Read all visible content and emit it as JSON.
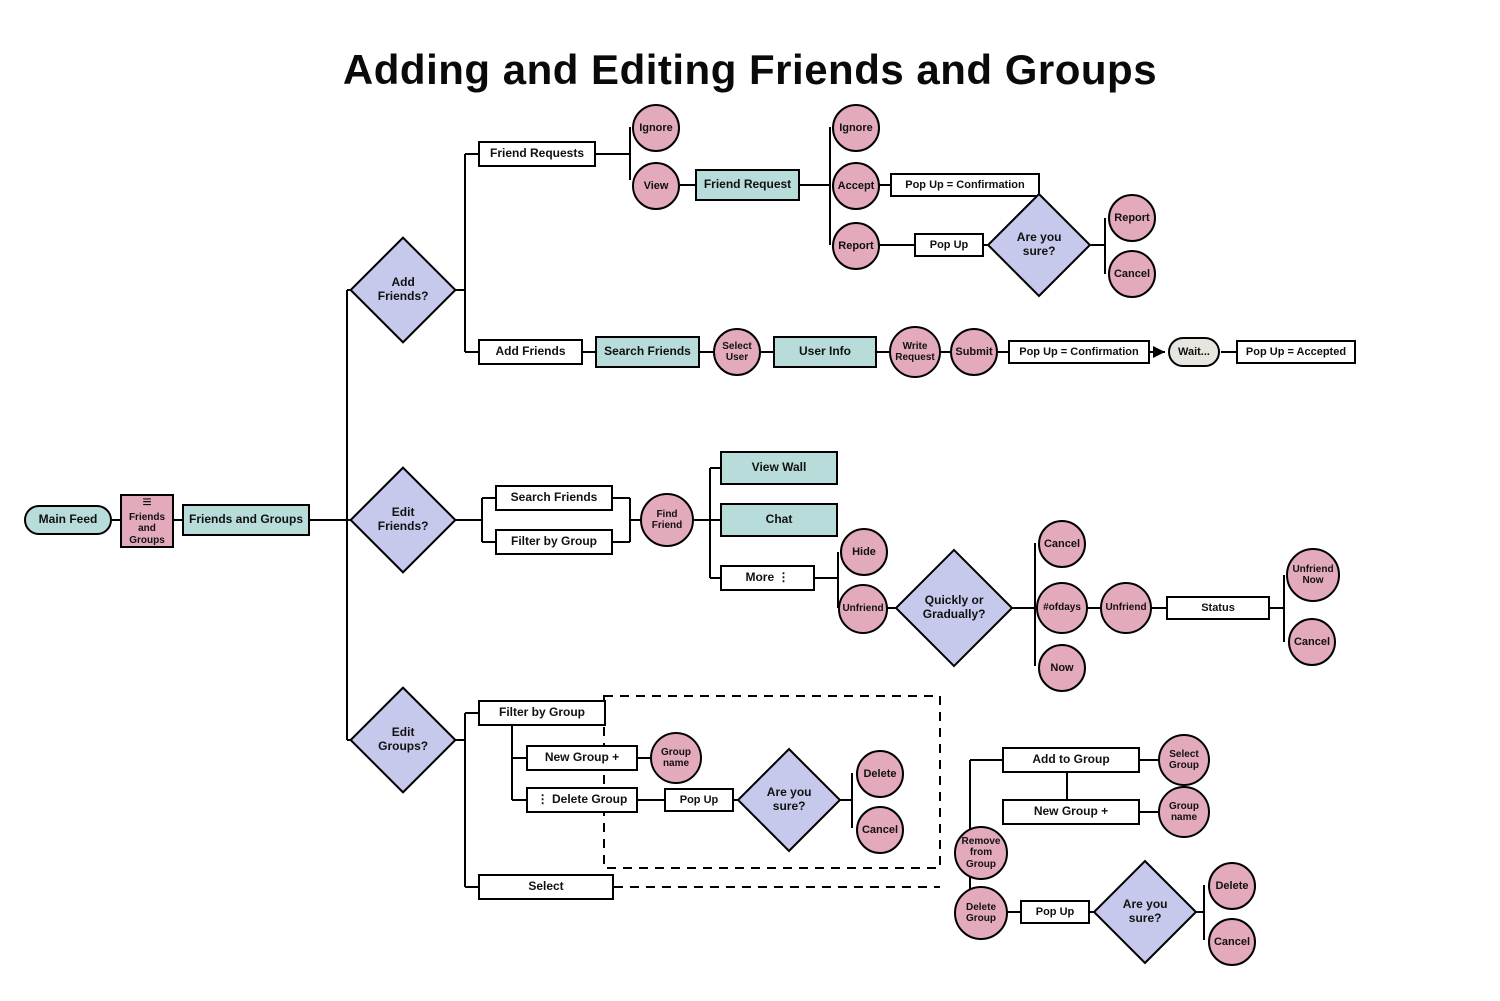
{
  "title": "Adding and Editing Friends and Groups",
  "start": {
    "mainFeed": "Main Feed",
    "friendsGroupsBtn": "Friends and Groups",
    "friendsGroupsPage": "Friends and Groups"
  },
  "decisions": {
    "addFriends": "Add Friends?",
    "editFriends": "Edit Friends?",
    "editGroups": "Edit Groups?",
    "areYouSure1": "Are you sure?",
    "areYouSure2": "Are you sure?",
    "areYouSure3": "Are you sure?",
    "quicklyGradually": "Quickly or Gradually?"
  },
  "addFriends": {
    "friendRequests": "Friend Requests",
    "ignore1": "Ignore",
    "view": "View",
    "friendRequest": "Friend Request",
    "ignore2": "Ignore",
    "accept": "Accept",
    "report": "Report",
    "popupConfirm": "Pop Up = Confirmation",
    "popup": "Pop Up",
    "report2": "Report",
    "cancel": "Cancel",
    "addFriends": "Add Friends",
    "searchFriends": "Search Friends",
    "selectUser": "Select User",
    "userInfo": "User Info",
    "writeRequest": "Write Request",
    "submit": "Submit",
    "popupConfirm2": "Pop Up = Confirmation",
    "wait": "Wait...",
    "popupAccepted": "Pop Up = Accepted"
  },
  "editFriends": {
    "searchFriends": "Search Friends",
    "filterByGroup": "Filter by Group",
    "findFriend": "Find Friend",
    "viewWall": "View Wall",
    "chat": "Chat",
    "more": "More ⋮",
    "hide": "Hide",
    "unfriend": "Unfriend",
    "cancel": "Cancel",
    "ofDays": "#ofdays",
    "now": "Now",
    "unfriend2": "Unfriend",
    "status": "Status",
    "unfriendNow": "Unfriend Now",
    "cancel2": "Cancel"
  },
  "editGroups": {
    "filterByGroup": "Filter by Group",
    "newGroup": "New Group +",
    "groupName": "Group name",
    "deleteGroup": "⋮ Delete Group",
    "popup": "Pop Up",
    "delete": "Delete",
    "cancel": "Cancel",
    "select": "Select",
    "addToGroup": "Add to Group",
    "selectGroup": "Select Group",
    "newGroup2": "New Group +",
    "groupName2": "Group name",
    "removeFromGroup": "Remove from Group",
    "deleteGroup2": "Delete Group",
    "popup2": "Pop Up",
    "delete2": "Delete",
    "cancel2": "Cancel"
  }
}
